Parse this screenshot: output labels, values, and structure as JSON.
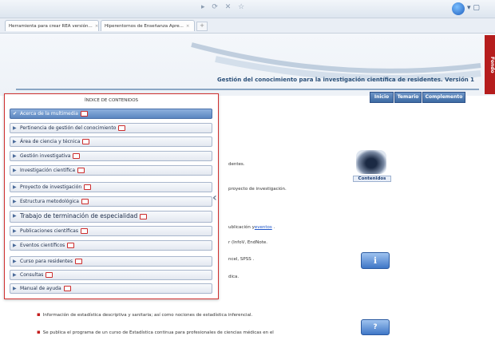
{
  "browser": {
    "tabs": [
      {
        "label": "Herramienta para crear REA versión..."
      },
      {
        "label": "Hiperentornos de Enseñanza Apre..."
      }
    ],
    "new_tab": "+"
  },
  "header": {
    "title": "Gestión del conocimiento para la investigación científica de residentes. Versión 1",
    "side_tab": "Fondo"
  },
  "nav_buttons": [
    {
      "label": "Inicio"
    },
    {
      "label": "Temario"
    },
    {
      "label": "Complemento"
    }
  ],
  "toc": {
    "title": "ÍNDICE DE CONTENIDOS",
    "items": [
      {
        "label": "Acerca de la multimedia",
        "active": true
      },
      {
        "label": "Pertinencia de gestión del conocimiento"
      },
      {
        "label": "Área de ciencia y técnica"
      },
      {
        "label": "Gestión investigativa"
      },
      {
        "label": "Investigación científica"
      },
      {
        "label": "Proyecto de investigación"
      },
      {
        "label": "Estructura metodológica"
      },
      {
        "label": "Trabajo de terminación de especialidad"
      },
      {
        "label": "Publicaciones científicas"
      },
      {
        "label": "Eventos científicos"
      },
      {
        "label": "Curso para residentes"
      },
      {
        "label": "Consultas"
      },
      {
        "label": "Manual de ayuda"
      }
    ]
  },
  "content": {
    "partial_lines": [
      {
        "text": "dentes."
      },
      {
        "text": "proyecto de investigación."
      },
      {
        "text": "ublicación y",
        "link": "eventos",
        "after": " ."
      },
      {
        "text": "r (InfoV, EndNote."
      },
      {
        "text": "ncel, SPSS ."
      },
      {
        "text": "dica."
      }
    ],
    "bullets": [
      "Información de estadística descriptiva y sanitaria; así como nociones de estadística inferencial.",
      "Se publica el programa de un curso de Estadística continua para profesionales de ciencias médicas en el"
    ],
    "contenidos_label": "Contenidos",
    "info_icon": "ℹ",
    "help_icon": "?"
  }
}
